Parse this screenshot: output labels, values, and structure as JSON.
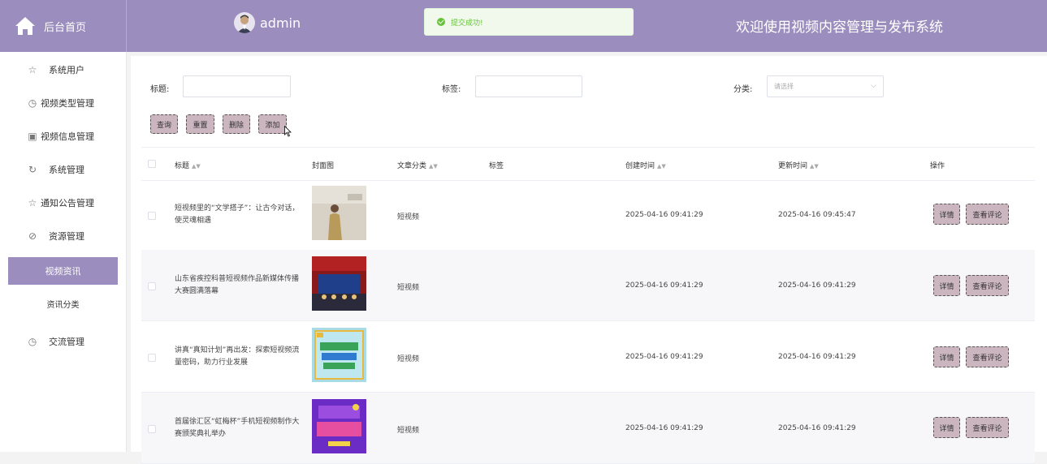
{
  "header": {
    "home_label": "后台首页",
    "username": "admin",
    "toast": "提交成功!",
    "welcome": "欢迎使用视频内容管理与发布系统",
    "accent_color": "#9b8dbd"
  },
  "sidebar": {
    "items": [
      {
        "label": "系统用户",
        "icon": "star-icon"
      },
      {
        "label": "视频类型管理",
        "icon": "clock-icon"
      },
      {
        "label": "视频信息管理",
        "icon": "box-icon"
      },
      {
        "label": "系统管理",
        "icon": "refresh-icon"
      },
      {
        "label": "通知公告管理",
        "icon": "star-icon"
      },
      {
        "label": "资源管理",
        "icon": "compass-icon"
      },
      {
        "label": "视频资讯",
        "icon": ""
      },
      {
        "label": "资讯分类",
        "icon": ""
      },
      {
        "label": "交流管理",
        "icon": "clock-icon"
      }
    ]
  },
  "filters": {
    "title_label": "标题:",
    "tag_label": "标签:",
    "category_label": "分类:",
    "category_placeholder": "请选择"
  },
  "actions": {
    "search": "查询",
    "reset": "重置",
    "delete": "删除",
    "add": "添加"
  },
  "table": {
    "headers": {
      "title": "标题",
      "cover": "封面图",
      "category": "文章分类",
      "tags": "标签",
      "created": "创建时间",
      "updated": "更新时间",
      "ops": "操作"
    },
    "detail_label": "详情",
    "comments_label": "查看评论",
    "rows": [
      {
        "title": "短视频里的“文学搭子”：让古今对话，使灵魂相遇",
        "category": "短视频",
        "tags": "",
        "created": "2025-04-16 09:41:29",
        "updated": "2025-04-16 09:45:47"
      },
      {
        "title": "山东省疾控科普短视频作品新媒体传播大赛圆满落幕",
        "category": "短视频",
        "tags": "",
        "created": "2025-04-16 09:41:29",
        "updated": "2025-04-16 09:41:29"
      },
      {
        "title": "讲真“真知计划”再出发：探索短视频流量密码，助力行业发展",
        "category": "短视频",
        "tags": "",
        "created": "2025-04-16 09:41:29",
        "updated": "2025-04-16 09:41:29"
      },
      {
        "title": "首届徐汇区“虹梅杯”手机短视频制作大赛颁奖典礼举办",
        "category": "短视频",
        "tags": "",
        "created": "2025-04-16 09:41:29",
        "updated": "2025-04-16 09:41:29"
      }
    ]
  }
}
